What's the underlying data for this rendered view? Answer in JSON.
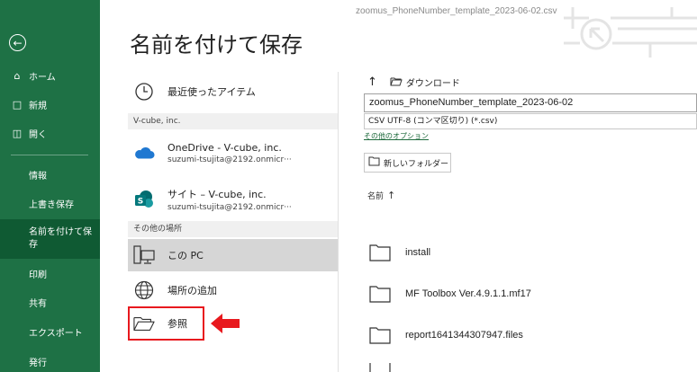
{
  "window": {
    "file_title": "zoomus_PhoneNumber_template_2023-06-02.csv"
  },
  "sidebar": {
    "back_icon": "back-arrow-icon",
    "items": [
      {
        "label": "ホーム",
        "icon": "home-icon"
      },
      {
        "label": "新規",
        "icon": "new-document-icon"
      },
      {
        "label": "開く",
        "icon": "open-folder-icon"
      },
      {
        "label": "情報"
      },
      {
        "label": "上書き保存"
      },
      {
        "label": "名前を付けて保存",
        "selected": true
      },
      {
        "label": "印刷"
      },
      {
        "label": "共有"
      },
      {
        "label": "エクスポート"
      },
      {
        "label": "発行"
      }
    ]
  },
  "page": {
    "title": "名前を付けて保存"
  },
  "locations": {
    "recent": {
      "label": "最近使ったアイテム",
      "icon": "clock-icon"
    },
    "section_org": "V-cube, inc.",
    "onedrive": {
      "name": "OneDrive - V-cube, inc.",
      "account": "suzumi-tsujita@2192.onmicr···",
      "icon": "onedrive-cloud-icon"
    },
    "sharepoint": {
      "name": "サイト – V-cube, inc.",
      "account": "suzumi-tsujita@2192.onmicr···",
      "icon": "sharepoint-icon"
    },
    "section_other": "その他の場所",
    "this_pc": {
      "label": "この PC",
      "icon": "pc-icon",
      "selected": true
    },
    "add_place": {
      "label": "場所の追加",
      "icon": "globe-icon"
    },
    "browse": {
      "label": "参照",
      "icon": "browse-folder-icon"
    }
  },
  "save_panel": {
    "current_folder": "ダウンロード",
    "filename": "zoomus_PhoneNumber_template_2023-06-02",
    "filetype": "CSV UTF-8 (コンマ区切り) (*.csv)",
    "more_options": "その他のオプション",
    "new_folder": "新しいフォルダー",
    "sort_label": "名前",
    "files": [
      {
        "name": "install"
      },
      {
        "name": "MF Toolbox Ver.4.9.1.1.mf17"
      },
      {
        "name": "report1641344307947.files"
      }
    ]
  },
  "colors": {
    "sidebar_bg": "#1e7145",
    "sidebar_selected": "#0f5a33",
    "highlight": "#e8191e"
  }
}
